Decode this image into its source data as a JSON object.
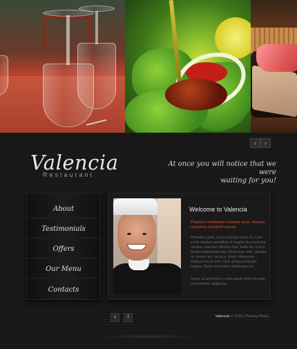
{
  "hero": {
    "panels": [
      "wine-glasses-photo",
      "salad-oil-photo",
      "sushi-photo"
    ]
  },
  "slider": {
    "prev_icon": "chevron-left-icon",
    "next_icon": "chevron-right-icon"
  },
  "brand": {
    "name": "Valencia",
    "sub": "Restaurant"
  },
  "tagline": {
    "line1": "At once you will notice that we were",
    "line2": "waiting for you!"
  },
  "menu": {
    "items": [
      {
        "label": "About"
      },
      {
        "label": "Testimonials"
      },
      {
        "label": "Offers"
      },
      {
        "label": "Our Menu"
      },
      {
        "label": "Contacts"
      }
    ]
  },
  "content": {
    "title": "Welcome to Valencia",
    "lead": "Praesent vestibulum molestie lacus. Aenean nonummy hendrerit mauris.",
    "body": "Phasellus porta. Fusce suscipit varius mi. Cum sociis natoque penatibus et magnis dis parturient montes, nascetur ridiculus mus. Nulla dui. Fusce feugiat malesuada odio. Morbi nunc odio, gravida at, cursus nec, luctus a, lorem. Maecenas tristique orci ac sem. Duis ultricies pharetra magna. Donec accumsan malesuada orci.",
    "body2": "Donec sit amet eros. Lorem ipsum dolor sit amet, consectetuer adipiscing."
  },
  "footer": {
    "brand": "Valencia",
    "copyright": "© 2011 |",
    "privacy": "Privacy Policy",
    "social": [
      {
        "label": "t",
        "icon": "twitter-icon"
      },
      {
        "label": "f",
        "icon": "facebook-icon"
      }
    ]
  },
  "colors": {
    "background": "#141414",
    "accent_red": "#e04a38",
    "text_light": "#e8e8e8"
  }
}
